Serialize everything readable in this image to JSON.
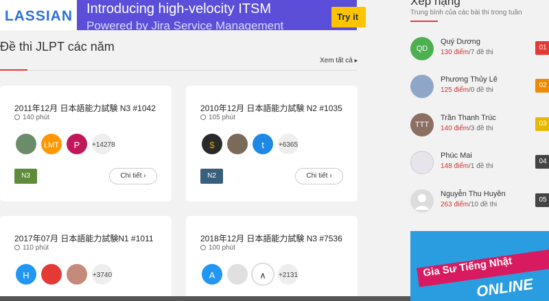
{
  "banner": {
    "logo": "LASSIAN",
    "title": "Introducing high-velocity ITSM",
    "subtitle": "Powered by Jira Service Management",
    "button": "Try it"
  },
  "section": {
    "title": "Đề thi JLPT các năm",
    "view_all": "Xem tất cả"
  },
  "exams": [
    {
      "title": "2011年12月 日本語能力試験 N3 #1042",
      "time": "140 phút",
      "avatars": [
        {
          "label": "",
          "color": "#6b8c6a"
        },
        {
          "label": "LMT",
          "color": "#ff9800"
        },
        {
          "label": "P",
          "color": "#c2185b"
        }
      ],
      "count": "+14278",
      "level": "N3",
      "level_color": "#5e8c3a",
      "detail": "Chi tiết"
    },
    {
      "title": "2010年12月 日本語能力試験 N2 #1035",
      "time": "105 phút",
      "avatars": [
        {
          "label": "",
          "color": "#2a2a2a"
        },
        {
          "label": "",
          "color": "#7a6a5a"
        },
        {
          "label": "t",
          "color": "#1e88e5"
        }
      ],
      "count": "+6365",
      "level": "N2",
      "level_color": "#3a5f7d",
      "detail": "Chi tiết"
    },
    {
      "title": "2017年07月 日本語能力試験N1 #1011",
      "time": "110 phút",
      "avatars": [
        {
          "label": "H",
          "color": "#2196f3"
        },
        {
          "label": "",
          "color": "#e53935"
        },
        {
          "label": "",
          "color": "#c48a7a"
        }
      ],
      "count": "+3740"
    },
    {
      "title": "2018年12月 日本語能力試験 N3 #7536",
      "time": "100 phút",
      "avatars": [
        {
          "label": "A",
          "color": "#2196f3"
        },
        {
          "label": "",
          "color": "#e0e0e0"
        },
        {
          "label": "",
          "color": "#ffffff"
        }
      ],
      "count": "+2131"
    }
  ],
  "ranking": {
    "title": "Xếp hạng",
    "subtitle": "Trung bình của các bài thi trong tuần",
    "items": [
      {
        "initials": "QD",
        "name": "Quý Dương",
        "points": "130 điểm",
        "tests": "/7 đề thi",
        "rank": "01",
        "avatar_color": "#4caf50",
        "rank_color": "#e53935"
      },
      {
        "initials": "",
        "name": "Phương Thủy Lê",
        "points": "125 điểm",
        "tests": "/0 đề thi",
        "rank": "02",
        "avatar_color": "#8fa6c8",
        "rank_color": "#ef8a00"
      },
      {
        "initials": "TTT",
        "name": "Trần Thanh Trúc",
        "points": "140 điểm",
        "tests": "/3 đề thi",
        "rank": "03",
        "avatar_color": "#8d6e63",
        "rank_color": "#e6b800"
      },
      {
        "initials": "",
        "name": "Phúc Mai",
        "points": "148 điểm",
        "tests": "/1 đề thi",
        "rank": "04",
        "avatar_color": "#e8e4ec",
        "rank_color": "#444444"
      },
      {
        "initials": "",
        "name": "Nguyễn Thu Huyền",
        "points": "263 điểm",
        "tests": "/10 đề thi",
        "rank": "05",
        "avatar_color": "#dcdcdc",
        "rank_color": "#444444"
      }
    ]
  },
  "ad": {
    "line1": "Gia Sư Tiếng Nhật",
    "line2": "ONLINE"
  }
}
